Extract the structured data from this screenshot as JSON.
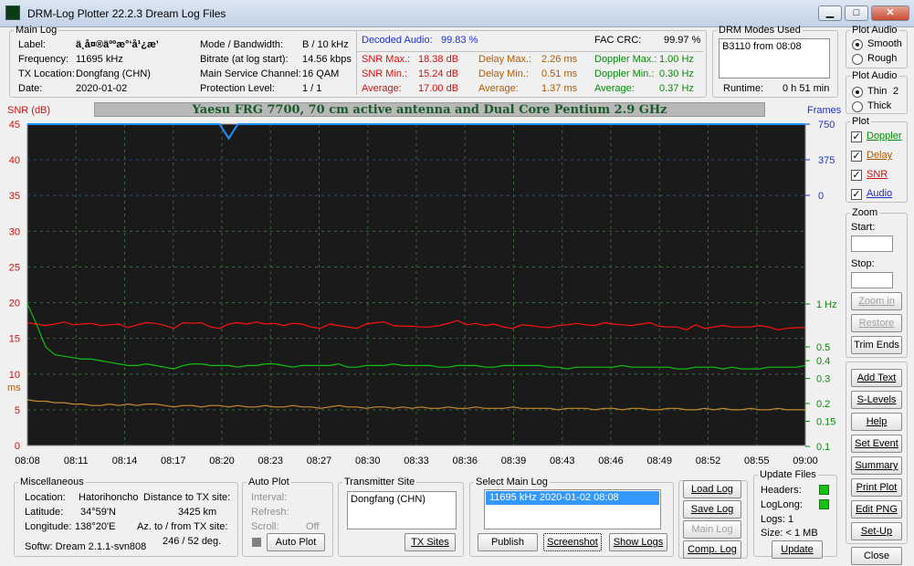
{
  "window": {
    "title": "DRM-Log Plotter 22.2.3   Dream Log Files",
    "min": "▁",
    "max": "□",
    "close": "✕"
  },
  "main_log": {
    "legend": "Main Log",
    "label_k": "Label:",
    "label_v": "ä¸­å¤®äººæ°‘å¹¿æ’­",
    "freq_k": "Frequency:",
    "freq_v": "11695   kHz",
    "tx_k": "TX Location:",
    "tx_v": "Dongfang (CHN)",
    "date_k": "Date:",
    "date_v": "2020-01-02",
    "mode_k": "Mode / Bandwidth:",
    "mode_v": "B / 10 kHz",
    "bitrate_k": "Bitrate (at log start):",
    "bitrate_v": "14.56 kbps",
    "msc_k": "Main Service Channel:",
    "msc_v": "16  QAM",
    "prot_k": "Protection Level:",
    "prot_v": "1 / 1",
    "dec_k": "Decoded Audio:",
    "dec_v": "99.83 %",
    "fac_k": "FAC  CRC:",
    "fac_v": "99.97 %",
    "snrmax_k": "SNR Max.:",
    "snrmax_v": "18.38  dB",
    "snrmin_k": "SNR Min.:",
    "snrmin_v": "15.24  dB",
    "snravg_k": "Average:",
    "snravg_v": "17.00  dB",
    "dmax_k": "Delay Max.:",
    "dmax_v": "2.26   ms",
    "dmin_k": "Delay Min.:",
    "dmin_v": "0.51   ms",
    "davg_k": "Average:",
    "davg_v": "1.37   ms",
    "dopmax_k": "Doppler Max.:",
    "dopmax_v": "1.00 Hz",
    "dopmin_k": "Doppler Min.:",
    "dopmin_v": "0.30 Hz",
    "dopavg_k": "Average:",
    "dopavg_v": "0.37 Hz"
  },
  "drm_modes": {
    "legend": "DRM Modes Used",
    "entry": "B3110 from 08:08",
    "runtime_k": "Runtime:",
    "runtime_v": "0 h 51 min"
  },
  "plot_audio": {
    "legend": "Plot Audio",
    "smooth": "Smooth",
    "rough": "Rough"
  },
  "plot_audio2": {
    "legend": "Plot Audio",
    "thin": "Thin",
    "thick": "Thick",
    "width": "2"
  },
  "plot_opts": {
    "legend": "Plot",
    "doppler": "Doppler",
    "delay": "Delay",
    "snr": "SNR",
    "audio": "Audio"
  },
  "zoom": {
    "legend": "Zoom",
    "start": "Start:",
    "stop": "Stop:",
    "zoom_in": "Zoom in",
    "restore": "Restore",
    "trim": "Trim Ends"
  },
  "side_buttons": {
    "add_text": "Add Text",
    "s_levels": "S-Levels",
    "help": "Help",
    "set_event": "Set Event",
    "summary": "Summary",
    "print_plot": "Print Plot",
    "edit_png": "Edit PNG",
    "set_up": "Set-Up",
    "close": "Close"
  },
  "chart_data": {
    "type": "line",
    "title": "Yaesu FRG 7700, 70 cm active antenna and Dual Core Pentium 2.9 GHz",
    "ylabel_left": "SNR (dB)",
    "ylabel_delay": "ms",
    "ylabel_right": "Frames",
    "left_ticks": [
      "45",
      "40",
      "35",
      "30",
      "25",
      "20",
      "15",
      "10",
      "5",
      "0"
    ],
    "right_frames_ticks": [
      "750",
      "375",
      "0"
    ],
    "right_hz_ticks": [
      "1 Hz",
      "0.5",
      "0.4",
      "0.3",
      "0.2",
      "0.15",
      "0.1"
    ],
    "x_ticks": [
      "08:08",
      "08:11",
      "08:14",
      "08:17",
      "08:20",
      "08:23",
      "08:27",
      "08:30",
      "08:33",
      "08:36",
      "08:39",
      "08:43",
      "08:46",
      "08:49",
      "08:52",
      "08:55",
      "09:00"
    ],
    "ylim": [
      0,
      45
    ],
    "series": [
      {
        "name": "SNR",
        "unit": "dB",
        "color": "#ff1010",
        "values": [
          17.2,
          17.0,
          16.8,
          17.0,
          17.3,
          16.9,
          17.0,
          17.1,
          16.8,
          16.9,
          17.0,
          16.5,
          16.9,
          17.2,
          17.1,
          16.8,
          16.4,
          17.2,
          17.1,
          17.2,
          16.6,
          16.4,
          17.0,
          17.2,
          17.0,
          17.3,
          17.0,
          17.1,
          16.8,
          17.1,
          17.0,
          16.6,
          16.4,
          17.0,
          16.8,
          16.6,
          16.4,
          17.0,
          17.2,
          17.3,
          16.8,
          16.7,
          16.7,
          16.6,
          16.6,
          16.8,
          17.1,
          17.5,
          16.9,
          17.1,
          16.8,
          17.0,
          16.6,
          16.4,
          16.9,
          16.8,
          16.6,
          16.5,
          16.8,
          16.9,
          17.1,
          16.9,
          16.8,
          17.2,
          17.0,
          16.9,
          16.8,
          17.0,
          17.2,
          16.7,
          16.6,
          16.6,
          16.2,
          16.9,
          16.4,
          16.6,
          16.8,
          16.6,
          16.6,
          16.6,
          16.8,
          16.6,
          16.2,
          16.4,
          16.5,
          16.5
        ]
      },
      {
        "name": "Doppler",
        "unit": "Hz",
        "color": "#10c010",
        "values": [
          1.0,
          0.72,
          0.5,
          0.44,
          0.43,
          0.42,
          0.41,
          0.41,
          0.4,
          0.39,
          0.38,
          0.37,
          0.37,
          0.38,
          0.37,
          0.36,
          0.35,
          0.37,
          0.38,
          0.38,
          0.37,
          0.37,
          0.37,
          0.36,
          0.37,
          0.37,
          0.38,
          0.38,
          0.37,
          0.36,
          0.37,
          0.37,
          0.37,
          0.37,
          0.38,
          0.36,
          0.36,
          0.37,
          0.37,
          0.37,
          0.38,
          0.37,
          0.37,
          0.37,
          0.37,
          0.36,
          0.36,
          0.37,
          0.37,
          0.37,
          0.36,
          0.36,
          0.37,
          0.37,
          0.37,
          0.37,
          0.37,
          0.36,
          0.36,
          0.35,
          0.36,
          0.36,
          0.36,
          0.36,
          0.36,
          0.37,
          0.36,
          0.36,
          0.36,
          0.36,
          0.36,
          0.35,
          0.35,
          0.36,
          0.36,
          0.36,
          0.35,
          0.36,
          0.35,
          0.35,
          0.35,
          0.36,
          0.36,
          0.36,
          0.36,
          0.37
        ]
      },
      {
        "name": "Delay",
        "unit": "ms",
        "color": "#c88a30",
        "values": [
          1.6,
          1.55,
          1.55,
          1.5,
          1.5,
          1.45,
          1.45,
          1.4,
          1.4,
          1.45,
          1.4,
          1.45,
          1.4,
          1.45,
          1.45,
          1.4,
          1.35,
          1.4,
          1.4,
          1.35,
          1.4,
          1.4,
          1.35,
          1.4,
          1.35,
          1.35,
          1.4,
          1.35,
          1.35,
          1.4,
          1.35,
          1.35,
          1.3,
          1.35,
          1.4,
          1.35,
          1.35,
          1.3,
          1.35,
          1.35,
          1.3,
          1.35,
          1.3,
          1.35,
          1.3,
          1.3,
          1.35,
          1.3,
          1.3,
          1.35,
          1.3,
          1.3,
          1.3,
          1.35,
          1.3,
          1.3,
          1.3,
          1.3,
          1.25,
          1.3,
          1.3,
          1.3,
          1.25,
          1.3,
          1.3,
          1.25,
          1.3,
          1.3,
          1.25,
          1.25,
          1.3,
          1.3,
          1.25,
          1.25,
          1.3,
          1.25,
          1.3,
          1.25,
          1.25,
          1.3,
          1.25,
          1.25,
          1.3,
          1.25,
          1.25,
          1.25
        ]
      },
      {
        "name": "Audio",
        "unit": "frames",
        "color": "#1e90ff",
        "values": [
          750,
          750,
          750,
          750,
          750,
          750,
          750,
          750,
          750,
          750,
          750,
          750,
          750,
          750,
          750,
          750,
          750,
          750,
          750,
          750,
          750,
          750,
          600,
          750,
          750,
          750,
          750,
          750,
          750,
          750,
          750,
          750,
          750,
          750,
          750,
          750,
          750,
          750,
          750,
          750,
          750,
          750,
          750,
          750,
          750,
          750,
          750,
          750,
          750,
          750,
          750,
          750,
          750,
          750,
          750,
          750,
          750,
          750,
          750,
          750,
          750,
          750,
          750,
          750,
          750,
          750,
          750,
          750,
          750,
          750,
          750,
          750,
          750,
          750,
          750,
          750,
          750,
          750,
          750,
          750,
          750,
          750,
          750,
          750,
          750,
          750
        ]
      }
    ]
  },
  "misc": {
    "legend": "Miscellaneous",
    "loc_k": "Location:",
    "loc_v": "Hatorihoncho",
    "lat_k": "Latitude:",
    "lat_v": "34°59'N",
    "lon_k": "Longitude:",
    "lon_v": "138°20'E",
    "dist_k": "Distance to TX site:",
    "dist_v": "3425     km",
    "az_k": "Az. to / from TX site:",
    "az_v": "246 / 52  deg.",
    "softw": "Softw: Dream 2.1.1-svn808"
  },
  "autoplot": {
    "legend": "Auto Plot",
    "interval": "Interval:",
    "refresh": "Refresh:",
    "scroll": "Scroll:",
    "scroll_v": "Off",
    "btn": "Auto Plot"
  },
  "tx_site": {
    "legend": "Transmitter Site",
    "item": "Dongfang (CHN)",
    "btn": "TX Sites"
  },
  "select_log": {
    "legend": "Select Main Log",
    "item": "11695 kHz  2020-01-02   08:08",
    "publish": "Publish",
    "screenshot": "Screenshot",
    "show_logs": "Show Logs"
  },
  "log_buttons": {
    "load": "Load Log",
    "save": "Save Log",
    "main": "Main Log",
    "comp": "Comp. Log"
  },
  "update_files": {
    "legend": "Update Files",
    "headers": "Headers:",
    "loglong": "LogLong:",
    "logs": "Logs: 1",
    "size": "Size:  < 1 MB",
    "btn": "Update"
  }
}
